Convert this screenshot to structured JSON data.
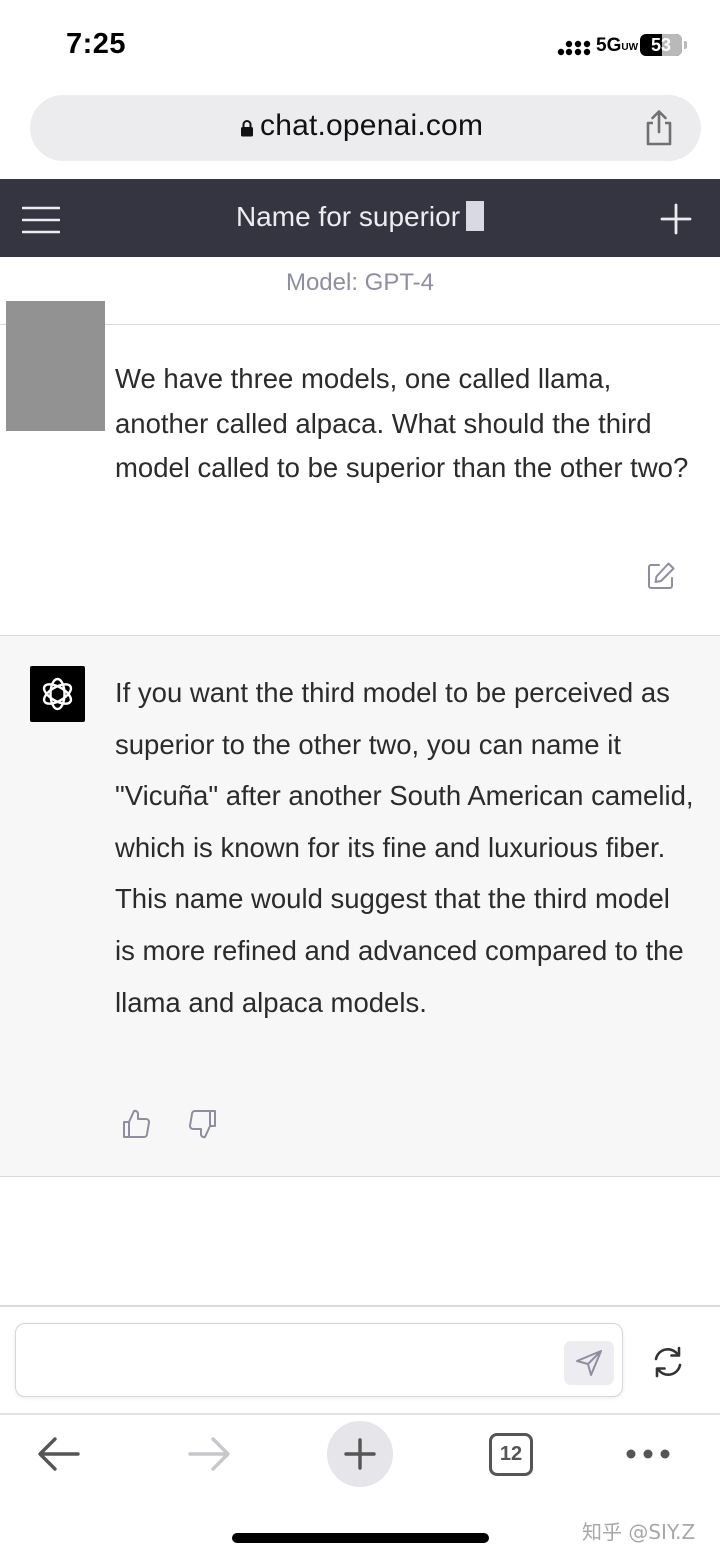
{
  "status_bar": {
    "time": "7:25",
    "network": "5G",
    "network_suffix": "UW",
    "battery": "53"
  },
  "browser": {
    "url": "chat.openai.com",
    "tab_count": "12"
  },
  "chat": {
    "title": "Name for superior",
    "model_label": "Model: GPT-4",
    "messages": [
      {
        "role": "user",
        "text": "We have three models, one called llama, another called alpaca. What should the third model called to be superior than the other two?"
      },
      {
        "role": "assistant",
        "text": "If you want the third model to be perceived as superior to the other two, you can name it \"Vicuña\" after another South American camelid, which is known for its fine and luxurious fiber. This name would suggest that the third model is more refined and advanced compared to the llama and alpaca models."
      }
    ],
    "composer": {
      "value": "",
      "placeholder": ""
    }
  },
  "watermark": "知乎 @SIY.Z",
  "colors": {
    "header_bg": "#343541",
    "assistant_bg": "#f7f7f8",
    "url_bar_bg": "#ececee"
  },
  "icons": [
    "lock-icon",
    "share-icon",
    "menu-icon",
    "plus-icon",
    "edit-icon",
    "openai-logo-icon",
    "thumbs-up-icon",
    "thumbs-down-icon",
    "send-icon",
    "regenerate-icon",
    "back-arrow-icon",
    "forward-arrow-icon",
    "more-icon"
  ]
}
